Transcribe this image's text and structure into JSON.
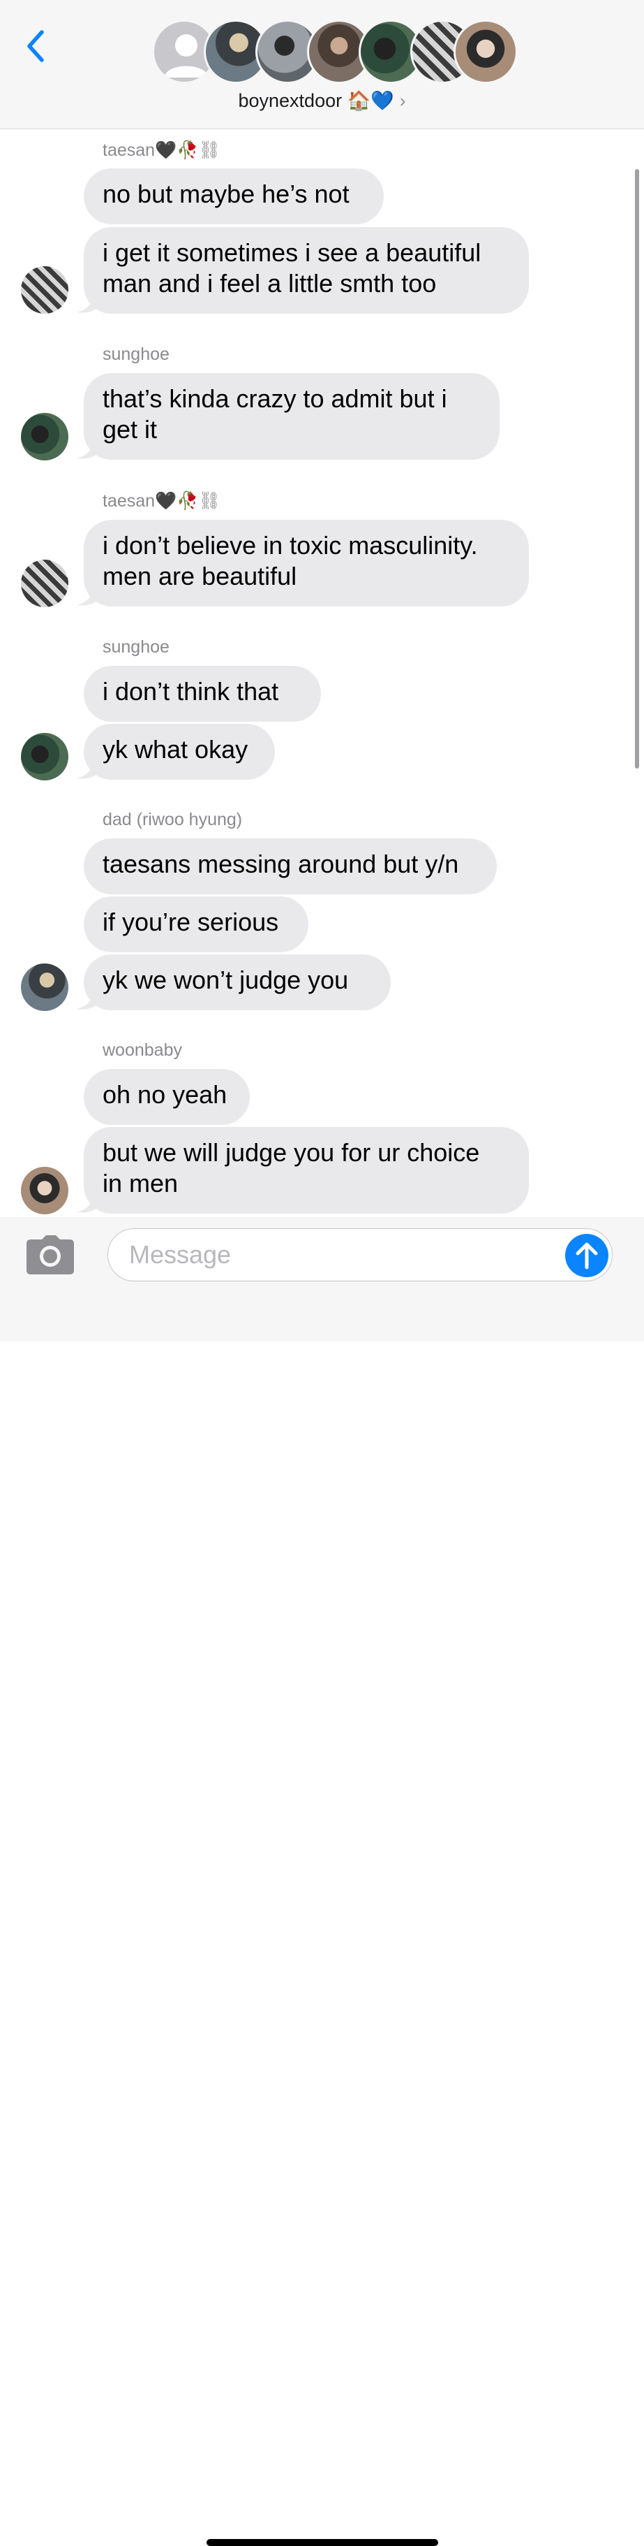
{
  "header": {
    "group_name": "boynextdoor 🏠💙",
    "chevron": "›",
    "back_icon": "chevron-left-icon"
  },
  "messages": [
    {
      "sender": "taesan🖤🥀⛓",
      "bubbles": [
        "no but maybe he’s not",
        "i get it sometimes i see a beautiful\nman and i feel a little smth too"
      ]
    },
    {
      "sender": "sunghoe",
      "bubbles": [
        "that’s kinda crazy to admit but i\nget it"
      ]
    },
    {
      "sender": "taesan🖤🥀⛓",
      "bubbles": [
        "i don’t believe in toxic masculinity.\nmen are beautiful"
      ]
    },
    {
      "sender": "sunghoe",
      "bubbles": [
        "i don’t think that",
        "yk what okay"
      ]
    },
    {
      "sender": "dad (riwoo hyung)",
      "bubbles": [
        "taesans messing around but y/n",
        "if you’re serious",
        "yk we won’t judge you"
      ]
    },
    {
      "sender": "woonbaby",
      "bubbles": [
        "oh no yeah",
        "but we will judge you for ur choice\nin men"
      ]
    }
  ],
  "composer": {
    "placeholder": "Message",
    "camera_icon": "camera-icon",
    "send_icon": "arrow-up-icon"
  },
  "colors": {
    "accent": "#0a84ff",
    "bubble_gray": "#e9e9eb",
    "header_bg": "#f6f6f7"
  }
}
